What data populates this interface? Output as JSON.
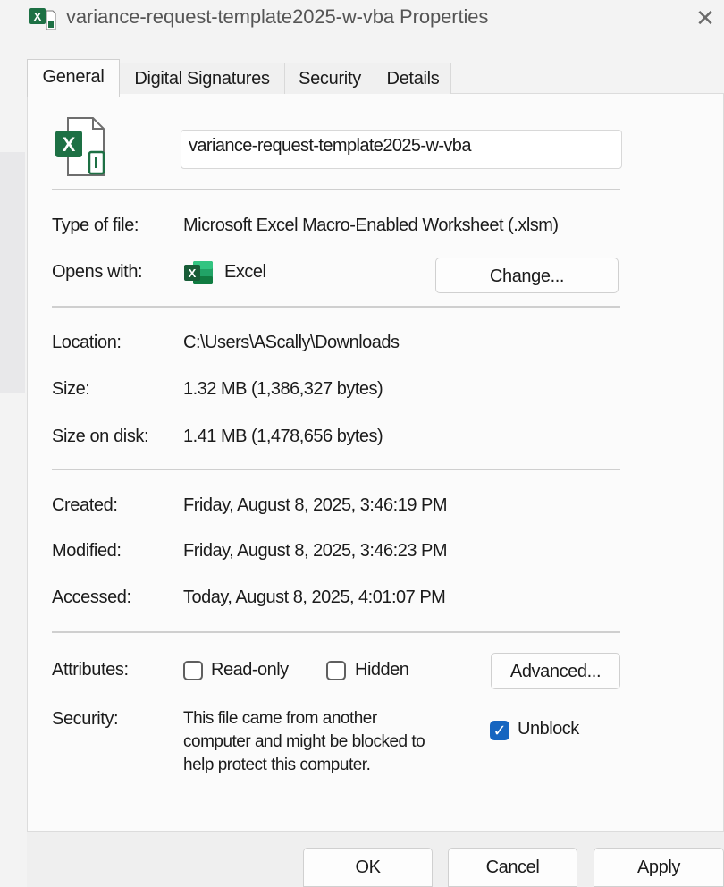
{
  "window": {
    "title": "variance-request-template2025-w-vba Properties",
    "close_glyph": "✕",
    "icon": "excel-file-icon"
  },
  "tabs": [
    {
      "label": "General",
      "active": true
    },
    {
      "label": "Digital Signatures",
      "active": false
    },
    {
      "label": "Security",
      "active": false
    },
    {
      "label": "Details",
      "active": false
    }
  ],
  "general": {
    "file_name": "variance-request-template2025-w-vba",
    "type_label": "Type of file:",
    "type_value": "Microsoft Excel Macro-Enabled Worksheet (.xlsm)",
    "opens_label": "Opens with:",
    "opens_app": "Excel",
    "change_button": "Change...",
    "location_label": "Location:",
    "location_value": "C:\\Users\\AScally\\Downloads",
    "size_label": "Size:",
    "size_value": "1.32 MB (1,386,327 bytes)",
    "size_disk_label": "Size on disk:",
    "size_disk_value": "1.41 MB (1,478,656 bytes)",
    "created_label": "Created:",
    "created_value": "Friday, August 8, 2025, 3:46:19 PM",
    "modified_label": "Modified:",
    "modified_value": "Friday, August 8, 2025, 3:46:23 PM",
    "accessed_label": "Accessed:",
    "accessed_value": "Today, August 8, 2025, 4:01:07 PM",
    "attributes_label": "Attributes:",
    "readonly_label": "Read-only",
    "readonly_checked": false,
    "hidden_label": "Hidden",
    "hidden_checked": false,
    "advanced_button": "Advanced...",
    "security_label": "Security:",
    "security_text_1": "This file came from another",
    "security_text_2": "computer and might be blocked to",
    "security_text_3": "help protect this computer.",
    "unblock_label": "Unblock",
    "unblock_checked": true,
    "unblock_check_glyph": "✓"
  },
  "footer": {
    "ok": "OK",
    "cancel": "Cancel",
    "apply": "Apply"
  },
  "colors": {
    "excel_green": "#1d7044",
    "excel_dark": "#185c37",
    "accent_blue": "#1565c0"
  }
}
